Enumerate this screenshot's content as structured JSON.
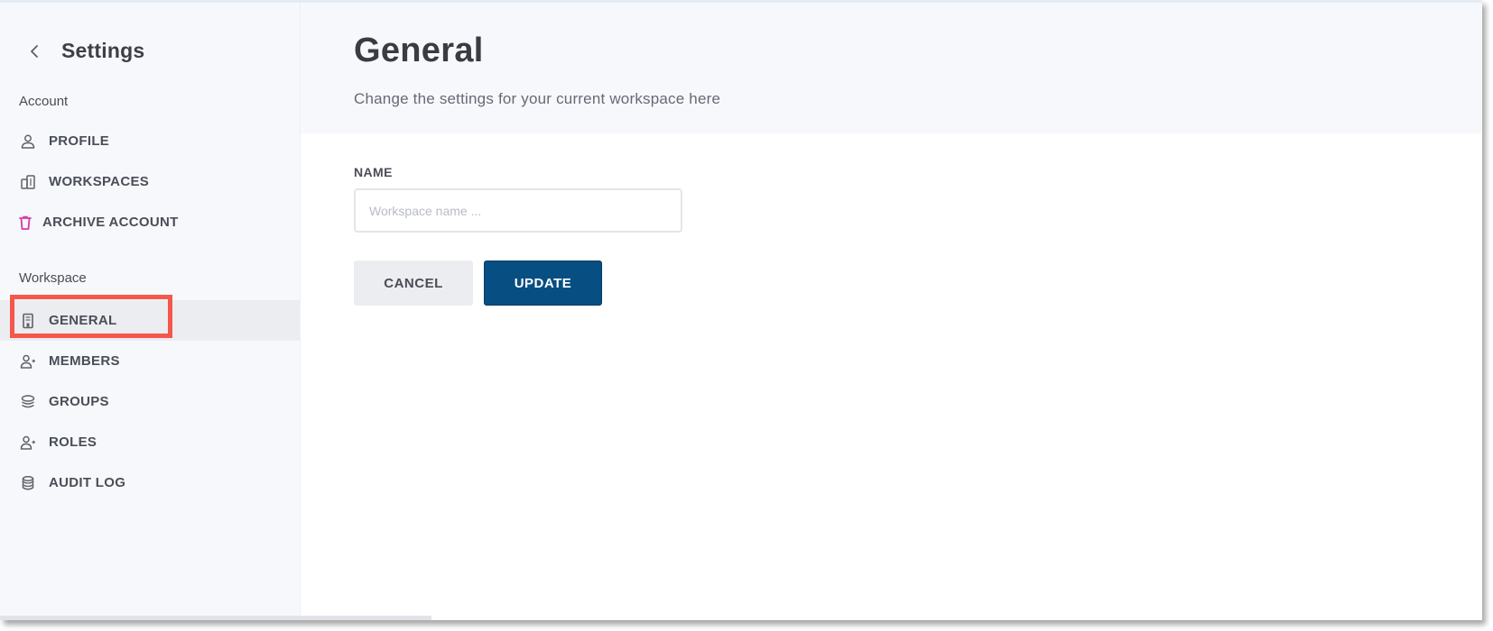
{
  "sidebar": {
    "back_icon": "chevron-left-icon",
    "title": "Settings",
    "sections": [
      {
        "label": "Account",
        "items": [
          {
            "label": "PROFILE",
            "icon": "user-icon",
            "active": false
          },
          {
            "label": "WORKSPACES",
            "icon": "buildings-icon",
            "active": false
          },
          {
            "label": "ARCHIVE ACCOUNT",
            "icon": "trash-icon",
            "active": false,
            "danger": true
          }
        ]
      },
      {
        "label": "Workspace",
        "items": [
          {
            "label": "GENERAL",
            "icon": "building-icon",
            "active": true
          },
          {
            "label": "MEMBERS",
            "icon": "user-plus-icon",
            "active": false
          },
          {
            "label": "GROUPS",
            "icon": "layers-icon",
            "active": false
          },
          {
            "label": "ROLES",
            "icon": "user-plus-icon",
            "active": false
          },
          {
            "label": "AUDIT LOG",
            "icon": "database-icon",
            "active": false
          }
        ]
      }
    ]
  },
  "main": {
    "title": "General",
    "subtitle": "Change the settings for your current workspace here",
    "form": {
      "name_label": "NAME",
      "name_value": "",
      "name_placeholder": "Workspace name ...",
      "cancel_label": "CANCEL",
      "update_label": "UPDATE"
    }
  },
  "colors": {
    "primary": "#074e82",
    "danger_icon": "#d63aa8",
    "annotation": "#f5574a",
    "sidebar_bg": "#f6f8fc",
    "active_item_bg": "#ecedf1"
  }
}
